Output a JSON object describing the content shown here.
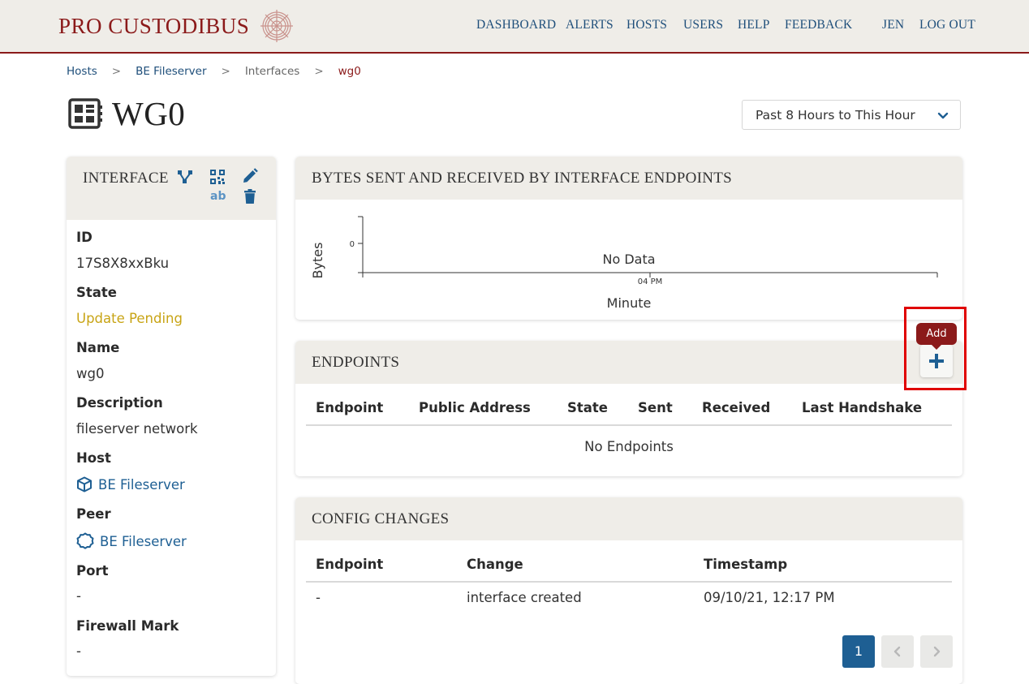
{
  "brand": {
    "name": "PRO CUSTODIBUS",
    "logo_icon": "rose-logo-icon"
  },
  "nav": {
    "dashboard": "DASHBOARD",
    "alerts": "ALERTS",
    "hosts": "HOSTS",
    "users": "USERS",
    "help": "HELP",
    "feedback": "FEEDBACK",
    "user": "JEN",
    "logout": "LOG OUT"
  },
  "breadcrumb": {
    "hosts": "Hosts",
    "host": "BE Fileserver",
    "interfaces": "Interfaces",
    "current": "wg0",
    "separator": ">"
  },
  "page": {
    "title": "WG0",
    "title_icon": "interface-card-icon",
    "time_range": "Past 8 Hours to This Hour"
  },
  "interface_card": {
    "title": "INTERFACE",
    "actions": {
      "topology_icon": "topology-icon",
      "qr_icon": "qr-code-icon",
      "ab_label": "ab",
      "edit_icon": "pencil-icon",
      "delete_icon": "trash-icon"
    },
    "fields": {
      "id_label": "ID",
      "id_value": "17S8X8xxBku",
      "state_label": "State",
      "state_value": "Update Pending",
      "name_label": "Name",
      "name_value": "wg0",
      "description_label": "Description",
      "description_value": "fileserver network",
      "host_label": "Host",
      "host_value": "BE Fileserver",
      "peer_label": "Peer",
      "peer_value": "BE Fileserver",
      "port_label": "Port",
      "port_value": "-",
      "firewall_label": "Firewall Mark",
      "firewall_value": "-"
    }
  },
  "chart_data": {
    "type": "line",
    "title": "BYTES SENT AND RECEIVED BY INTERFACE ENDPOINTS",
    "xlabel": "Minute",
    "ylabel": "Bytes",
    "x_ticks": [
      "04 PM"
    ],
    "y_ticks": [
      "0"
    ],
    "series": [],
    "empty_message": "No Data"
  },
  "endpoints": {
    "title": "ENDPOINTS",
    "columns": [
      "Endpoint",
      "Public Address",
      "State",
      "Sent",
      "Received",
      "Last Handshake"
    ],
    "empty_message": "No Endpoints",
    "add_tooltip": "Add",
    "add_icon": "plus-icon"
  },
  "config_changes": {
    "title": "CONFIG CHANGES",
    "columns": [
      "Endpoint",
      "Change",
      "Timestamp"
    ],
    "rows": [
      {
        "endpoint": "-",
        "change": "interface created",
        "timestamp": "09/10/21, 12:17 PM"
      }
    ],
    "pagination": {
      "current_page": "1"
    }
  },
  "colors": {
    "brand_red": "#8b1a1a",
    "link_blue": "#1e5f93",
    "pending_yellow": "#c8a415",
    "header_beige": "#efede8"
  }
}
